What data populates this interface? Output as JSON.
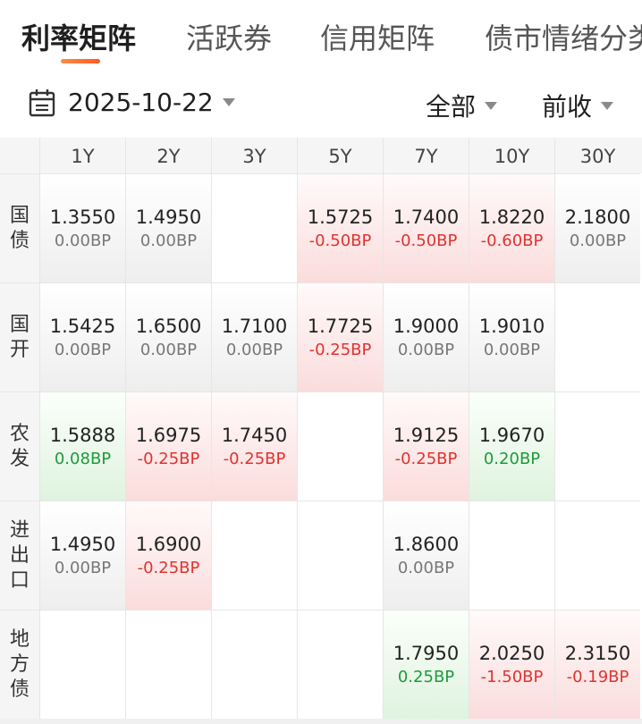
{
  "tabs": [
    {
      "label": "利率矩阵",
      "active": true
    },
    {
      "label": "活跃券",
      "active": false
    },
    {
      "label": "信用矩阵",
      "active": false
    },
    {
      "label": "债市情绪分类",
      "active": false
    }
  ],
  "filter": {
    "date": "2025-10-22",
    "scope": "全部",
    "compare": "前收"
  },
  "columns": [
    "1Y",
    "2Y",
    "3Y",
    "5Y",
    "7Y",
    "10Y",
    "30Y"
  ],
  "rows": [
    {
      "label": [
        "国",
        "债"
      ],
      "cells": [
        {
          "value": "1.3550",
          "change": "0.00BP",
          "trend": "gray"
        },
        {
          "value": "1.4950",
          "change": "0.00BP",
          "trend": "gray"
        },
        null,
        {
          "value": "1.5725",
          "change": "-0.50BP",
          "trend": "red"
        },
        {
          "value": "1.7400",
          "change": "-0.50BP",
          "trend": "red"
        },
        {
          "value": "1.8220",
          "change": "-0.60BP",
          "trend": "red"
        },
        {
          "value": "2.1800",
          "change": "0.00BP",
          "trend": "gray"
        }
      ]
    },
    {
      "label": [
        "国",
        "开"
      ],
      "cells": [
        {
          "value": "1.5425",
          "change": "0.00BP",
          "trend": "gray"
        },
        {
          "value": "1.6500",
          "change": "0.00BP",
          "trend": "gray"
        },
        {
          "value": "1.7100",
          "change": "0.00BP",
          "trend": "gray"
        },
        {
          "value": "1.7725",
          "change": "-0.25BP",
          "trend": "red"
        },
        {
          "value": "1.9000",
          "change": "0.00BP",
          "trend": "gray"
        },
        {
          "value": "1.9010",
          "change": "0.00BP",
          "trend": "gray"
        },
        null
      ]
    },
    {
      "label": [
        "农",
        "发"
      ],
      "cells": [
        {
          "value": "1.5888",
          "change": "0.08BP",
          "trend": "green"
        },
        {
          "value": "1.6975",
          "change": "-0.25BP",
          "trend": "red"
        },
        {
          "value": "1.7450",
          "change": "-0.25BP",
          "trend": "red"
        },
        null,
        {
          "value": "1.9125",
          "change": "-0.25BP",
          "trend": "red"
        },
        {
          "value": "1.9670",
          "change": "0.20BP",
          "trend": "green"
        },
        null
      ]
    },
    {
      "label": [
        "进",
        "出",
        "口"
      ],
      "cells": [
        {
          "value": "1.4950",
          "change": "0.00BP",
          "trend": "gray"
        },
        {
          "value": "1.6900",
          "change": "-0.25BP",
          "trend": "red"
        },
        null,
        null,
        {
          "value": "1.8600",
          "change": "0.00BP",
          "trend": "gray"
        },
        null,
        null
      ]
    },
    {
      "label": [
        "地",
        "方",
        "债"
      ],
      "cells": [
        null,
        null,
        null,
        null,
        {
          "value": "1.7950",
          "change": "0.25BP",
          "trend": "green"
        },
        {
          "value": "2.0250",
          "change": "-1.50BP",
          "trend": "red"
        },
        {
          "value": "2.3150",
          "change": "-0.19BP",
          "trend": "red"
        }
      ]
    }
  ],
  "colors": {
    "accent": "#ff5a1f",
    "up": "#e0322f",
    "down": "#1f9a3a",
    "flat": "#777777"
  },
  "icons": {
    "date": "calendar-icon",
    "dropdown": "caret-down-icon"
  }
}
